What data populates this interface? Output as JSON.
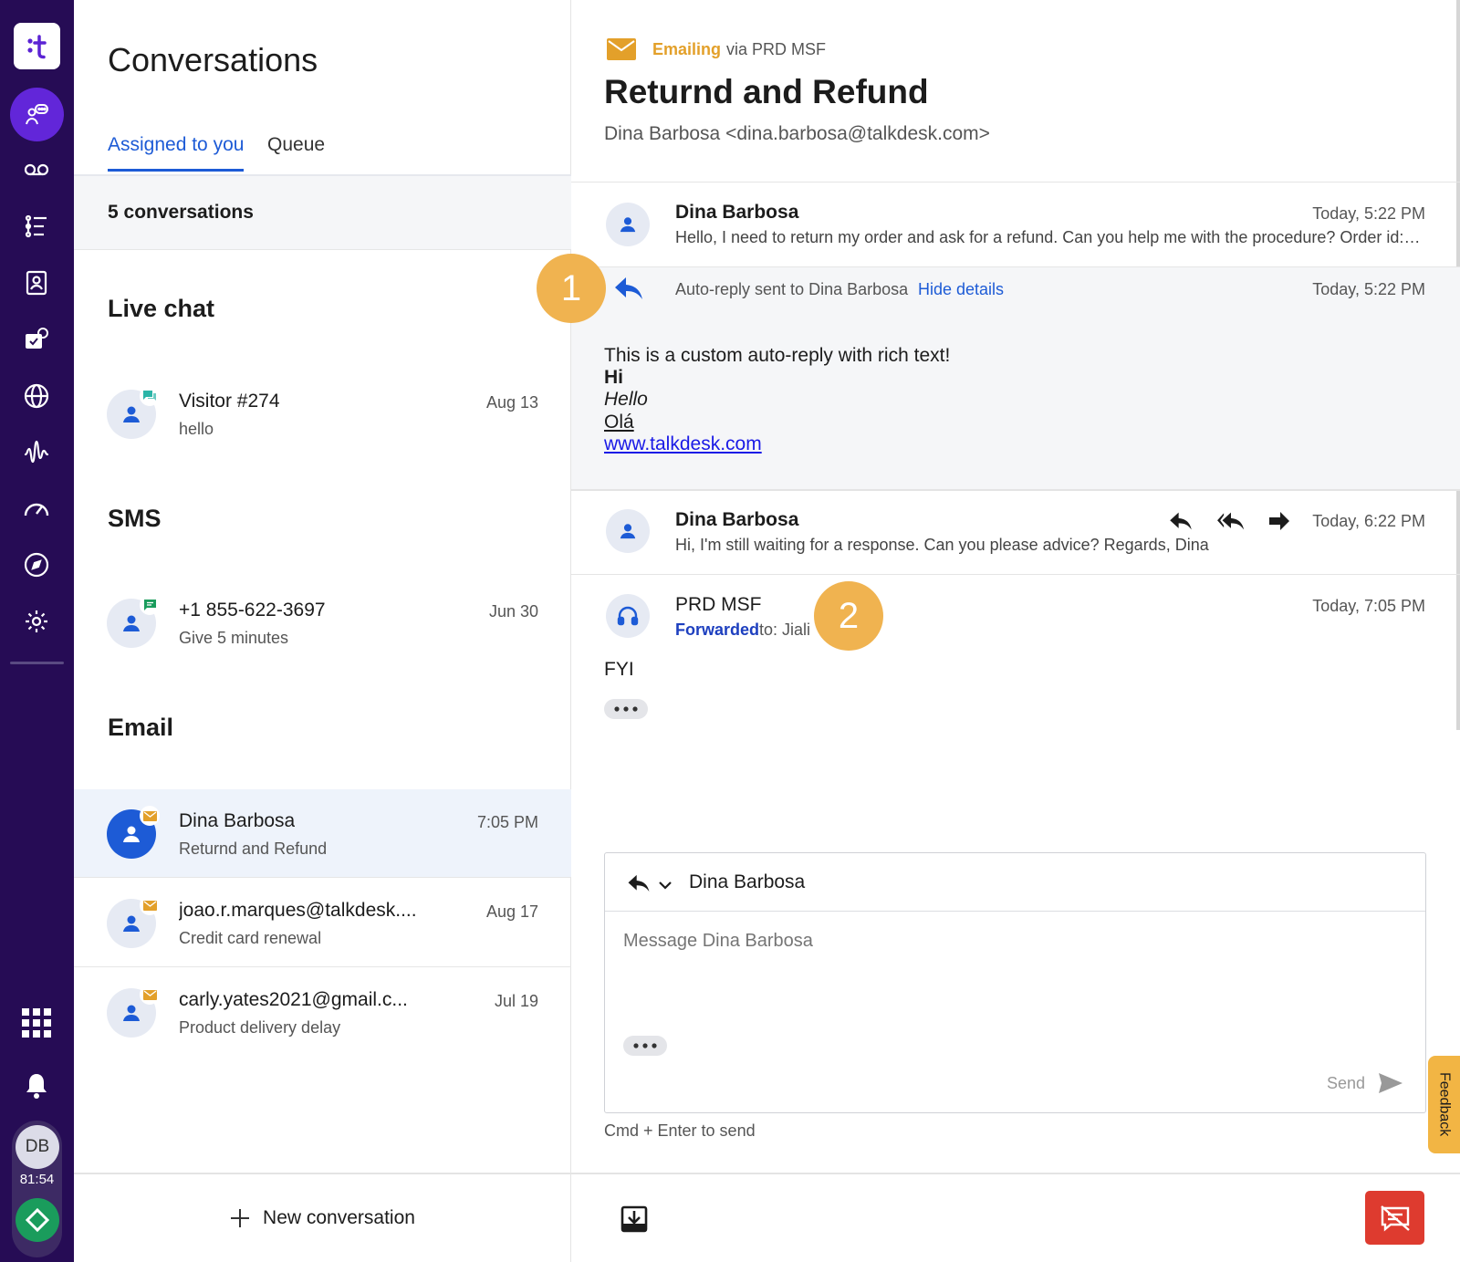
{
  "rail": {
    "logo_icon": "talkdesk-logo-icon",
    "items": [
      "conversations-icon",
      "voicemail-icon",
      "queue-list-icon",
      "contacts-icon",
      "case-settings-icon",
      "globe-icon",
      "waveform-icon",
      "dashboard-icon",
      "compass-icon",
      "gear-icon"
    ],
    "apps_icon": "grid-icon",
    "bell_icon": "bell-icon",
    "user_initials": "DB",
    "timer": "81:54",
    "status_icon": "diamond-status-icon",
    "colors": {
      "rail_bg": "#260c55",
      "active": "#6226d9",
      "status_ok": "#1a9c5c"
    }
  },
  "list": {
    "title": "Conversations",
    "tabs": [
      {
        "label": "Assigned to you",
        "active": true
      },
      {
        "label": "Queue",
        "active": false
      }
    ],
    "count": "5 conversations",
    "sections": [
      {
        "label": "Live chat",
        "items": [
          {
            "name": "Visitor #274",
            "preview": "hello",
            "date": "Aug 13",
            "channel": "chat-icon"
          }
        ]
      },
      {
        "label": "SMS",
        "items": [
          {
            "name": "+1 855-622-3697",
            "preview": "Give 5 minutes",
            "date": "Jun 30",
            "channel": "sms-icon"
          }
        ]
      },
      {
        "label": "Email",
        "items": [
          {
            "name": "Dina Barbosa",
            "preview": "Returnd and Refund",
            "date": "7:05 PM",
            "channel": "envelope-icon",
            "selected": true
          },
          {
            "name": "joao.r.marques@talkdesk....",
            "preview": "Credit card renewal",
            "date": "Aug 17",
            "channel": "envelope-icon"
          },
          {
            "name": "carly.yates2021@gmail.c...",
            "preview": "Product delivery delay",
            "date": "Jul 19",
            "channel": "envelope-icon"
          }
        ]
      }
    ],
    "new_conversation": "New conversation",
    "colors": {
      "accent": "#1d5bd6",
      "selected_bg": "#eef3fb",
      "sms": "#1a9c5c",
      "chat": "#2bb5a8",
      "email": "#e3a02a"
    }
  },
  "header": {
    "channel": "Emailing",
    "via": "via PRD MSF",
    "title": "Returnd and Refund",
    "from": "Dina Barbosa <dina.barbosa@talkdesk.com>"
  },
  "thread": {
    "msg1": {
      "name": "Dina Barbosa",
      "text": "Hello, I need to return my order and ask for a refund. Can you help me with the procedure? Order id: 1...",
      "time": "Today, 5:22 PM"
    },
    "auto": {
      "text": "Auto-reply sent to Dina Barbosa",
      "link": "Hide details",
      "time": "Today, 5:22 PM",
      "body": {
        "line1": "This is a custom auto-reply with rich text!",
        "bold": "Hi",
        "italic": "Hello",
        "underline": "Olá",
        "link": "www.talkdesk.com"
      }
    },
    "msg2": {
      "name": "Dina Barbosa",
      "text": "Hi, I'm still waiting for a response. Can you please advice? Regards, Dina",
      "time": "Today, 6:22 PM"
    },
    "msg3": {
      "name": "PRD MSF",
      "forwarded": "Forwarded",
      "to": "to: Jiali",
      "time": "Today, 7:05 PM",
      "body": "FYI"
    },
    "callouts": [
      "1",
      "2"
    ]
  },
  "compose": {
    "recipient": "Dina Barbosa",
    "placeholder": "Message Dina Barbosa",
    "send": "Send",
    "hint": "Cmd + Enter to send"
  },
  "feedback": "Feedback",
  "end_color": "#de3b2f"
}
